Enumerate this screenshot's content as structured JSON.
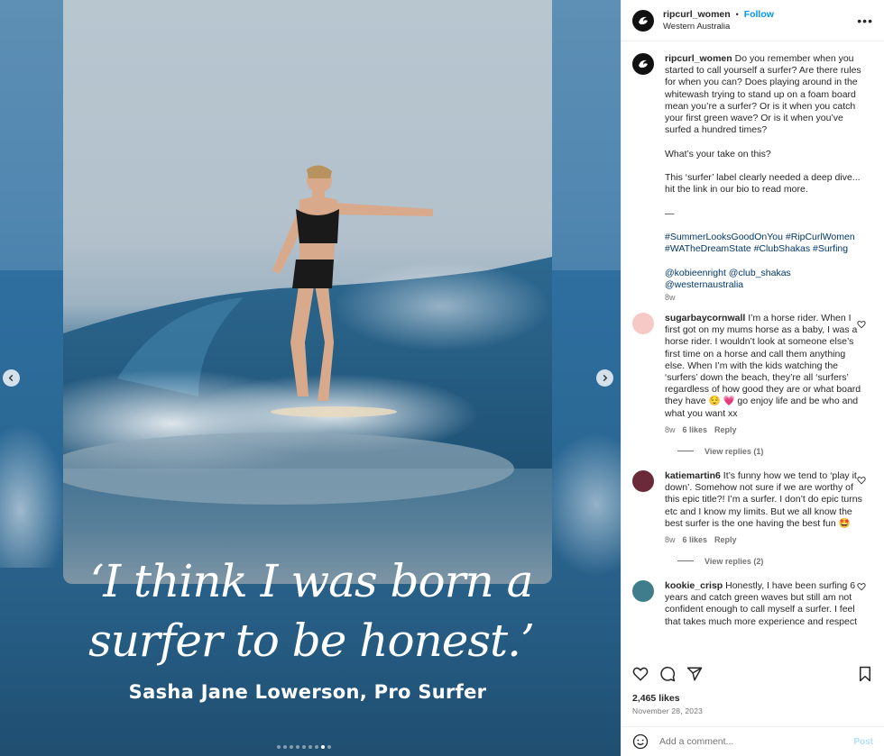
{
  "post": {
    "username": "ripcurl_women",
    "follow_label": "Follow",
    "separator": "•",
    "location": "Western Australia",
    "more_label": "•••"
  },
  "image": {
    "quote_line1": "‘I think I was born a",
    "quote_line2": "surfer to be honest.’",
    "byline": "Sasha Jane Lowerson, Pro Surfer",
    "carousel_dots": 9,
    "active_dot": 7
  },
  "caption": {
    "username": "ripcurl_women",
    "body": " Do you remember when you started to call yourself a surfer? Are there rules for when you can? Does playing around in the whitewash trying to stand up on a foam board mean you’re a surfer? Or is it when you catch your first green wave? Or is it when you’ve surfed a hundred times?\n\nWhat’s your take on this?\n\nThis ‘surfer’ label clearly needed a deep dive... hit the link in our bio to read more.\n\n—\n\n",
    "hashtags": "#SummerLooksGoodOnYou #RipCurlWomen #WATheDreamState #ClubShakas #Surfing\n\n@kobieenright @club_shakas @westernaustralia",
    "age": "8w"
  },
  "comments": [
    {
      "username": "sugarbaycornwall",
      "text": " I’m a horse rider. When I first got on my mums horse as a baby, I was a horse rider. I wouldn’t look at someone else’s first time on a horse and call them anything else. When I’m with the kids watching the ‘surfers’ down the beach, they’re all ‘surfers’ regardless of how good they are or what board they have 😌 💗 go enjoy life and be who and what you want xx",
      "age": "8w",
      "likes": "6 likes",
      "reply": "Reply",
      "view_replies": "View replies (1)",
      "avatar_color": "#f6c9c6"
    },
    {
      "username": "katiemartin6",
      "text": " It’s funny how we tend to ‘play it down’. Somehow not sure if we are worthy of this epic title?! I’m a surfer. I don’t do epic turns etc and I know my limits. But we all know the best surfer is the one having the best fun 🤩",
      "age": "8w",
      "likes": "6 likes",
      "reply": "Reply",
      "view_replies": "View replies (2)",
      "avatar_color": "#6b2a3a"
    },
    {
      "username": "kookie_crisp",
      "text": " Honestly, I have been surfing 6 years and catch green waves but still am not confident enough to call myself a surfer. I feel that takes much more experience and respect",
      "avatar_color": "#3f7d8c"
    }
  ],
  "footer": {
    "likes": "2,465 likes",
    "date": "November 28, 2023",
    "comment_placeholder": "Add a comment...",
    "post_label": "Post"
  },
  "icons": [
    "heart-icon",
    "comment-icon",
    "share-icon",
    "bookmark-icon",
    "emoji-icon",
    "chevron-left-icon",
    "chevron-right-icon",
    "more-icon"
  ]
}
